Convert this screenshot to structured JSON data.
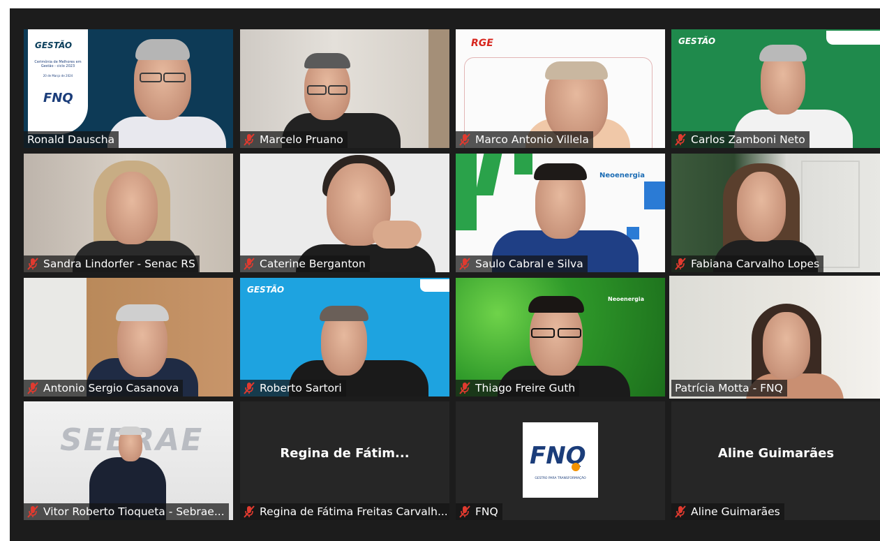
{
  "participants": [
    {
      "name": "Ronald Dauscha",
      "muted": false
    },
    {
      "name": "Marcelo Pruano",
      "muted": true
    },
    {
      "name": "Marco Antonio Villela",
      "muted": true
    },
    {
      "name": "Carlos Zamboni Neto",
      "muted": true
    },
    {
      "name": "Sandra Lindorfer - Senac RS",
      "muted": true
    },
    {
      "name": "Caterine Berganton",
      "muted": true
    },
    {
      "name": "Saulo Cabral e Silva",
      "muted": true
    },
    {
      "name": "Fabiana Carvalho Lopes",
      "muted": true
    },
    {
      "name": "Antonio Sergio Casanova",
      "muted": true
    },
    {
      "name": "Roberto Sartori",
      "muted": true
    },
    {
      "name": "Thiago Freire Guth",
      "muted": true
    },
    {
      "name": "Patrícia Motta - FNQ",
      "muted": false,
      "active_speaker": true
    },
    {
      "name": "Vitor Roberto Tioqueta - Sebrae...",
      "muted": true
    },
    {
      "name": "Regina de Fátima Freitas Carvalh...",
      "center_label": "Regina de Fátim...",
      "muted": true
    },
    {
      "name": "FNQ",
      "muted": true
    },
    {
      "name": "Aline Guimarães",
      "center_label": "Aline Guimarães",
      "muted": true
    }
  ],
  "backgrounds": {
    "gestao_logo": "GESTÃO",
    "gestao_caption": "Cerimônia de Melhores em Gestão - ciclo 2023",
    "gestao_date": "20 de Março de 2024",
    "fnq_logo": "FNQ",
    "fnq_tagline": "GESTÃO PARA TRANSFORMAÇÃO",
    "rge_logo": "RGE",
    "neoenergia_logo": "Neoenergia",
    "sebrae_logo": "SEBRAE"
  },
  "colors": {
    "stage": "#1c1c1c",
    "muted_mic": "#e03a2f",
    "active_border": "#e3f08a",
    "gestao_blue": "#0b3f5c",
    "gestao_green": "#1f8a4c",
    "sky_blue": "#1ea3e0",
    "fnq_blue": "#1b3d7a",
    "fnq_orange": "#f39200"
  },
  "icons": {
    "muted": "mic-muted-icon"
  }
}
